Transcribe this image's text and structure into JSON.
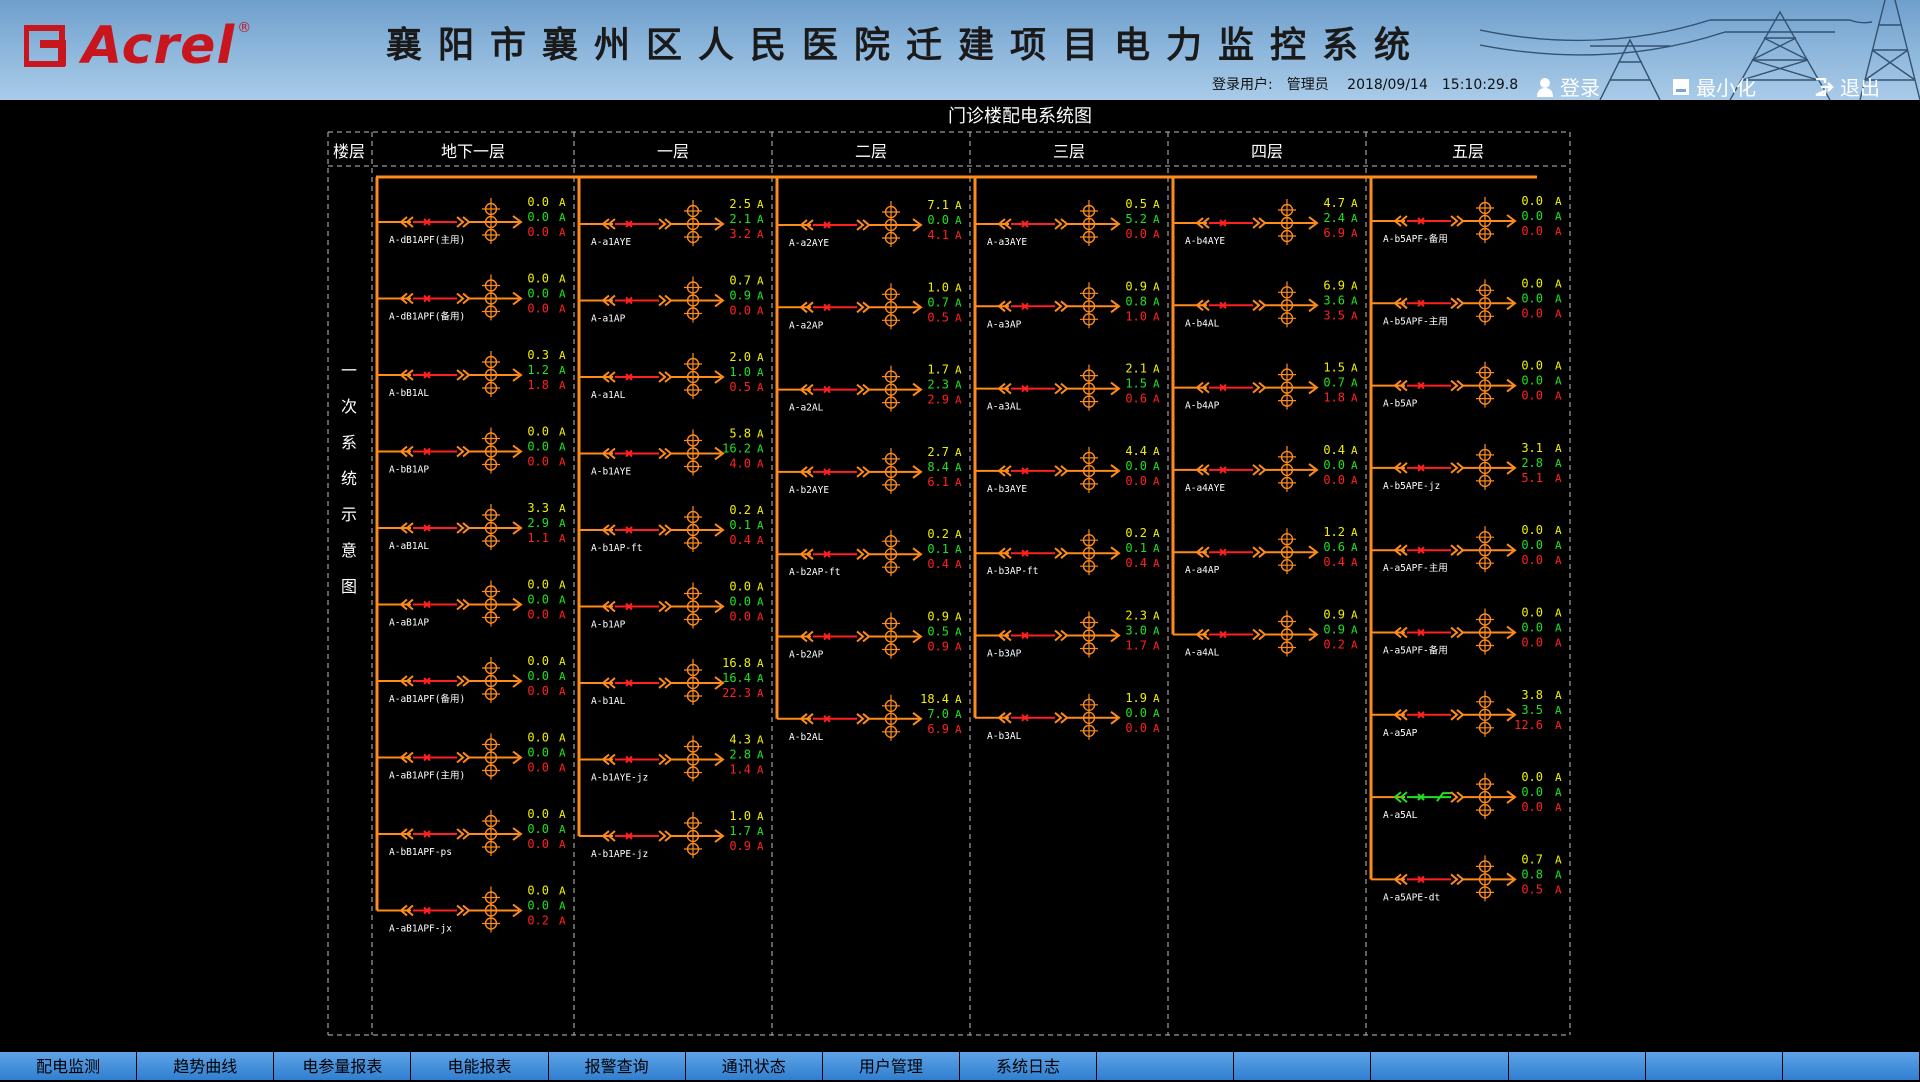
{
  "header": {
    "logo_text": "Acrel",
    "logo_reg": "®",
    "title": "襄阳市襄州区人民医院迁建项目电力监控系统",
    "user_label": "登录用户:",
    "user_name": "管理员",
    "date": "2018/09/14",
    "time": "15:10:29.8",
    "login_label": "登录",
    "minimize_label": "最小化",
    "exit_label": "退出"
  },
  "diagram": {
    "title": "门诊楼配电系统图",
    "floor_label": "楼层",
    "side_label": [
      "一",
      "次",
      "系",
      "统",
      "示",
      "意",
      "图"
    ],
    "unit": "A",
    "colors": {
      "bus": "#ff8c1a",
      "breaker_closed": "#ff2020",
      "breaker_open": "#20e020",
      "phase_a": "#f0f000",
      "phase_b": "#20e020",
      "phase_c": "#ff2020",
      "grid": "#bfbfbf"
    },
    "columns": [
      {
        "name": "地下一层",
        "circuits": [
          {
            "label": "A-dB1APF(主用)",
            "a": "0.0",
            "b": "0.0",
            "c": "0.0"
          },
          {
            "label": "A-dB1APF(备用)",
            "a": "0.0",
            "b": "0.0",
            "c": "0.0"
          },
          {
            "label": "A-bB1AL",
            "a": "0.3",
            "b": "1.2",
            "c": "1.8"
          },
          {
            "label": "A-bB1AP",
            "a": "0.0",
            "b": "0.0",
            "c": "0.0"
          },
          {
            "label": "A-aB1AL",
            "a": "3.3",
            "b": "2.9",
            "c": "1.1"
          },
          {
            "label": "A-aB1AP",
            "a": "0.0",
            "b": "0.0",
            "c": "0.0"
          },
          {
            "label": "A-aB1APF(备用)",
            "a": "0.0",
            "b": "0.0",
            "c": "0.0"
          },
          {
            "label": "A-aB1APF(主用)",
            "a": "0.0",
            "b": "0.0",
            "c": "0.0"
          },
          {
            "label": "A-bB1APF-ps",
            "a": "0.0",
            "b": "0.0",
            "c": "0.0"
          },
          {
            "label": "A-aB1APF-jx",
            "a": "0.0",
            "b": "0.0",
            "c": "0.2"
          }
        ]
      },
      {
        "name": "一层",
        "circuits": [
          {
            "label": "A-a1AYE",
            "a": "2.5",
            "b": "2.1",
            "c": "3.2"
          },
          {
            "label": "A-a1AP",
            "a": "0.7",
            "b": "0.9",
            "c": "0.0"
          },
          {
            "label": "A-a1AL",
            "a": "2.0",
            "b": "1.0",
            "c": "0.5"
          },
          {
            "label": "A-b1AYE",
            "a": "5.8",
            "b": "16.2",
            "c": "4.0"
          },
          {
            "label": "A-b1AP-ft",
            "a": "0.2",
            "b": "0.1",
            "c": "0.4"
          },
          {
            "label": "A-b1AP",
            "a": "0.0",
            "b": "0.0",
            "c": "0.0"
          },
          {
            "label": "A-b1AL",
            "a": "16.8",
            "b": "16.4",
            "c": "22.3"
          },
          {
            "label": "A-b1AYE-jz",
            "a": "4.3",
            "b": "2.8",
            "c": "1.4"
          },
          {
            "label": "A-b1APE-jz",
            "a": "1.0",
            "b": "1.7",
            "c": "0.9"
          }
        ]
      },
      {
        "name": "二层",
        "circuits": [
          {
            "label": "A-a2AYE",
            "a": "7.1",
            "b": "0.0",
            "c": "4.1"
          },
          {
            "label": "A-a2AP",
            "a": "1.0",
            "b": "0.7",
            "c": "0.5"
          },
          {
            "label": "A-a2AL",
            "a": "1.7",
            "b": "2.3",
            "c": "2.9"
          },
          {
            "label": "A-b2AYE",
            "a": "2.7",
            "b": "8.4",
            "c": "6.1"
          },
          {
            "label": "A-b2AP-ft",
            "a": "0.2",
            "b": "0.1",
            "c": "0.4"
          },
          {
            "label": "A-b2AP",
            "a": "0.9",
            "b": "0.5",
            "c": "0.9"
          },
          {
            "label": "A-b2AL",
            "a": "18.4",
            "b": "7.0",
            "c": "6.9"
          }
        ]
      },
      {
        "name": "三层",
        "circuits": [
          {
            "label": "A-a3AYE",
            "a": "0.5",
            "b": "5.2",
            "c": "0.0"
          },
          {
            "label": "A-a3AP",
            "a": "0.9",
            "b": "0.8",
            "c": "1.0"
          },
          {
            "label": "A-a3AL",
            "a": "2.1",
            "b": "1.5",
            "c": "0.6"
          },
          {
            "label": "A-b3AYE",
            "a": "4.4",
            "b": "0.0",
            "c": "0.0"
          },
          {
            "label": "A-b3AP-ft",
            "a": "0.2",
            "b": "0.1",
            "c": "0.4"
          },
          {
            "label": "A-b3AP",
            "a": "2.3",
            "b": "3.0",
            "c": "1.7"
          },
          {
            "label": "A-b3AL",
            "a": "1.9",
            "b": "0.0",
            "c": "0.0"
          }
        ]
      },
      {
        "name": "四层",
        "circuits": [
          {
            "label": "A-b4AYE",
            "a": "4.7",
            "b": "2.4",
            "c": "6.9"
          },
          {
            "label": "A-b4AL",
            "a": "6.9",
            "b": "3.6",
            "c": "3.5"
          },
          {
            "label": "A-b4AP",
            "a": "1.5",
            "b": "0.7",
            "c": "1.8"
          },
          {
            "label": "A-a4AYE",
            "a": "0.4",
            "b": "0.0",
            "c": "0.0"
          },
          {
            "label": "A-a4AP",
            "a": "1.2",
            "b": "0.6",
            "c": "0.4"
          },
          {
            "label": "A-a4AL",
            "a": "0.9",
            "b": "0.9",
            "c": "0.2"
          }
        ]
      },
      {
        "name": "五层",
        "circuits": [
          {
            "label": "A-b5APF-备用",
            "a": "0.0",
            "b": "0.0",
            "c": "0.0"
          },
          {
            "label": "A-b5APF-主用",
            "a": "0.0",
            "b": "0.0",
            "c": "0.0"
          },
          {
            "label": "A-b5AP",
            "a": "0.0",
            "b": "0.0",
            "c": "0.0"
          },
          {
            "label": "A-b5APE-jz",
            "a": "3.1",
            "b": "2.8",
            "c": "5.1"
          },
          {
            "label": "A-a5APF-主用",
            "a": "0.0",
            "b": "0.0",
            "c": "0.0"
          },
          {
            "label": "A-a5APF-备用",
            "a": "0.0",
            "b": "0.0",
            "c": "0.0"
          },
          {
            "label": "A-a5AP",
            "a": "3.8",
            "b": "3.5",
            "c": "12.6"
          },
          {
            "label": "A-a5AL",
            "a": "0.0",
            "b": "0.0",
            "c": "0.0",
            "open": true
          },
          {
            "label": "A-a5APE-dt",
            "a": "0.7",
            "b": "0.8",
            "c": "0.5"
          }
        ]
      }
    ]
  },
  "nav": {
    "tabs": [
      "配电监测",
      "趋势曲线",
      "电参量报表",
      "电能报表",
      "报警查询",
      "通讯状态",
      "用户管理",
      "系统日志",
      "",
      "",
      "",
      "",
      "",
      ""
    ]
  }
}
